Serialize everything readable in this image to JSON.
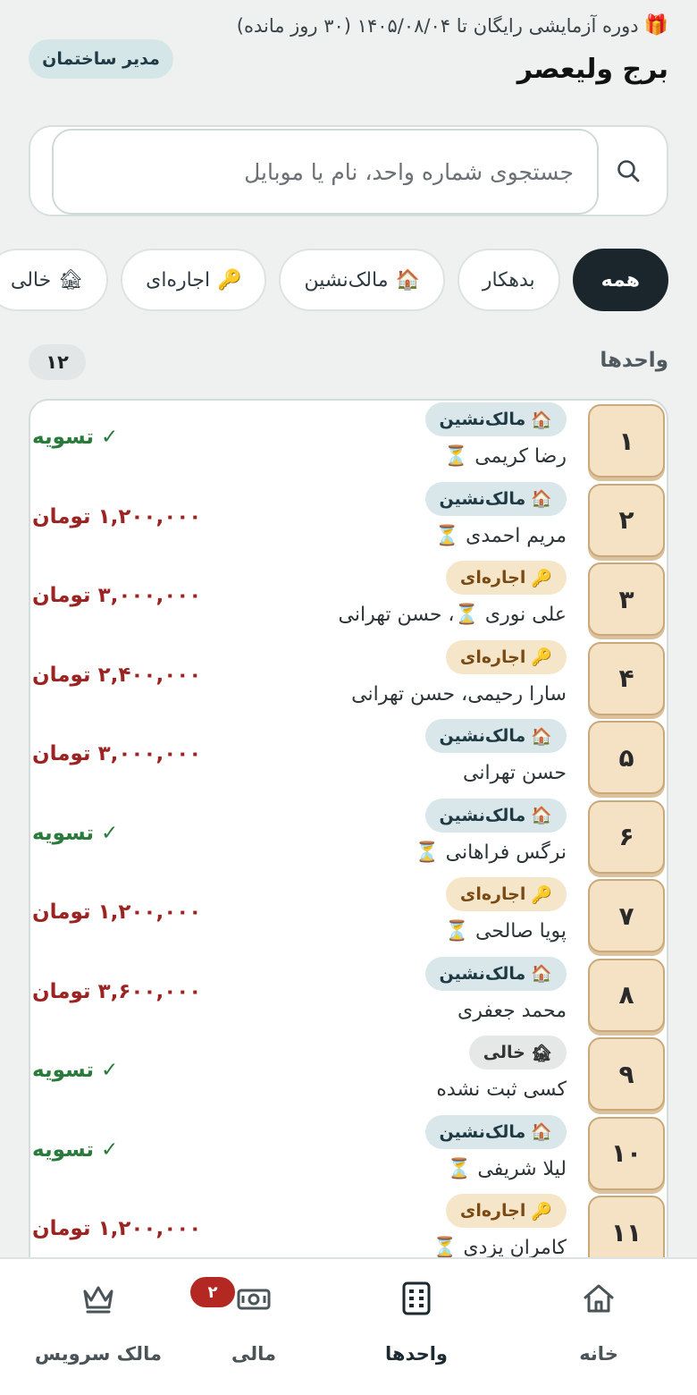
{
  "header": {
    "trial_text": "دوره آزمایشی رایگان تا ۱۴۰۵/۰۸/۰۴ (۳۰ روز مانده)",
    "gift_emoji": "🎁",
    "building_name": "برج ولیعصر",
    "role": "مدیر ساختمان"
  },
  "search": {
    "placeholder": "جستجوی شماره واحد، نام یا موبایل",
    "icon": "search-icon"
  },
  "filters": [
    {
      "label": "همه",
      "emoji": "",
      "active": true
    },
    {
      "label": "بدهکار",
      "emoji": "",
      "active": false
    },
    {
      "label": "مالک‌نشین",
      "emoji": "🏠",
      "active": false
    },
    {
      "label": "اجاره‌ای",
      "emoji": "🔑",
      "active": false
    },
    {
      "label": "خالی",
      "emoji": "🏚",
      "active": false
    }
  ],
  "units_section": {
    "title": "واحدها",
    "count": "۱۲"
  },
  "units": [
    {
      "number": "۱",
      "badge_emoji": "🏠",
      "badge_label": "مالک‌نشین",
      "badge_type": "owner",
      "occupant": "رضا کریمی ⏳",
      "amount": "✓ تسویه",
      "amount_type": "settled"
    },
    {
      "number": "۲",
      "badge_emoji": "🏠",
      "badge_label": "مالک‌نشین",
      "badge_type": "owner",
      "occupant": "مریم احمدی ⏳",
      "amount": "۱,۲۰۰,۰۰۰ تومان",
      "amount_type": "debt"
    },
    {
      "number": "۳",
      "badge_emoji": "🔑",
      "badge_label": "اجاره‌ای",
      "badge_type": "rent",
      "occupant": "علی نوری ⏳، حسن تهرانی",
      "amount": "۳,۰۰۰,۰۰۰ تومان",
      "amount_type": "debt"
    },
    {
      "number": "۴",
      "badge_emoji": "🔑",
      "badge_label": "اجاره‌ای",
      "badge_type": "rent",
      "occupant": "سارا رحیمی، حسن تهرانی",
      "amount": "۲,۴۰۰,۰۰۰ تومان",
      "amount_type": "debt"
    },
    {
      "number": "۵",
      "badge_emoji": "🏠",
      "badge_label": "مالک‌نشین",
      "badge_type": "owner",
      "occupant": "حسن تهرانی",
      "amount": "۳,۰۰۰,۰۰۰ تومان",
      "amount_type": "debt"
    },
    {
      "number": "۶",
      "badge_emoji": "🏠",
      "badge_label": "مالک‌نشین",
      "badge_type": "owner",
      "occupant": "نرگس فراهانی ⏳",
      "amount": "✓ تسویه",
      "amount_type": "settled"
    },
    {
      "number": "۷",
      "badge_emoji": "🔑",
      "badge_label": "اجاره‌ای",
      "badge_type": "rent",
      "occupant": "پویا صالحی ⏳",
      "amount": "۱,۲۰۰,۰۰۰ تومان",
      "amount_type": "debt"
    },
    {
      "number": "۸",
      "badge_emoji": "🏠",
      "badge_label": "مالک‌نشین",
      "badge_type": "owner",
      "occupant": "محمد جعفری",
      "amount": "۳,۶۰۰,۰۰۰ تومان",
      "amount_type": "debt"
    },
    {
      "number": "۹",
      "badge_emoji": "🏚",
      "badge_label": "خالی",
      "badge_type": "empty",
      "occupant": "کسی ثبت نشده",
      "amount": "✓ تسویه",
      "amount_type": "settled"
    },
    {
      "number": "۱۰",
      "badge_emoji": "🏠",
      "badge_label": "مالک‌نشین",
      "badge_type": "owner",
      "occupant": "لیلا شریفی ⏳",
      "amount": "✓ تسویه",
      "amount_type": "settled"
    },
    {
      "number": "۱۱",
      "badge_emoji": "🔑",
      "badge_label": "اجاره‌ای",
      "badge_type": "rent",
      "occupant": "کامران یزدی ⏳",
      "amount": "۱,۲۰۰,۰۰۰ تومان",
      "amount_type": "debt"
    }
  ],
  "bottom_nav": [
    {
      "label": "خانه",
      "icon": "home-icon",
      "active": false
    },
    {
      "label": "واحدها",
      "icon": "units-grid-icon",
      "active": true
    },
    {
      "label": "مالی",
      "icon": "cash-icon",
      "active": false,
      "badge": "۲"
    },
    {
      "label": "مالک سرویس",
      "icon": "crown-icon",
      "active": false
    }
  ],
  "colors": {
    "background": "#eef1f0",
    "dark": "#1b262c",
    "debt": "#9b2423",
    "settled": "#2a7a3c",
    "unit_tile": "#f5e2c4",
    "owner_badge": "#d9e7ea",
    "rent_badge": "#f6e6c9",
    "nav_badge": "#b32822"
  }
}
